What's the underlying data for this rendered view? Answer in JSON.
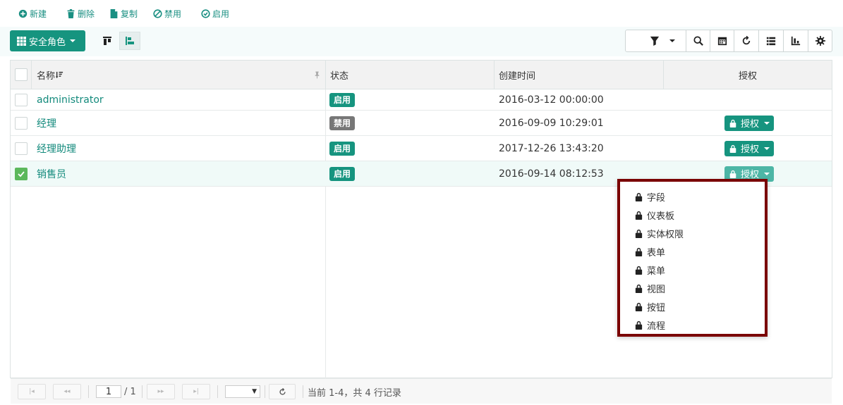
{
  "actions": [
    {
      "label": "新建",
      "icon": "plus-circle-icon"
    },
    {
      "label": "删除",
      "icon": "trash-icon"
    },
    {
      "label": "复制",
      "icon": "file-icon"
    },
    {
      "label": "禁用",
      "icon": "ban-icon"
    },
    {
      "label": "启用",
      "icon": "check-circle-icon"
    }
  ],
  "toolbar": {
    "role_button_label": "安全角色",
    "tools": [
      "filter-icon",
      "search-icon",
      "calendar-icon",
      "refresh-icon",
      "list-icon",
      "chart-icon",
      "gear-icon"
    ]
  },
  "table": {
    "headers": {
      "name": "名称",
      "status": "状态",
      "created": "创建时间",
      "auth": "授权"
    },
    "rows": [
      {
        "name": "administrator",
        "status": "启用",
        "status_type": "on",
        "created": "2016-03-12 00:00:00",
        "auth": "",
        "checked": false
      },
      {
        "name": "经理",
        "status": "禁用",
        "status_type": "off",
        "created": "2016-09-09 10:29:01",
        "auth": "授权",
        "checked": false
      },
      {
        "name": "经理助理",
        "status": "启用",
        "status_type": "on",
        "created": "2017-12-26 13:43:20",
        "auth": "授权",
        "checked": false
      },
      {
        "name": "销售员",
        "status": "启用",
        "status_type": "on",
        "created": "2016-09-14 08:12:53",
        "auth": "授权",
        "checked": true
      }
    ]
  },
  "dropdown": {
    "items": [
      "字段",
      "仪表板",
      "实体权限",
      "表单",
      "菜单",
      "视图",
      "按钮",
      "流程"
    ]
  },
  "pager": {
    "page": "1",
    "total_pages": "/ 1",
    "summary": "当前 1-4，共 4 行记录"
  },
  "colors": {
    "accent": "#16947f",
    "disabled_badge": "#777777",
    "highlight_border": "#7a0000"
  }
}
